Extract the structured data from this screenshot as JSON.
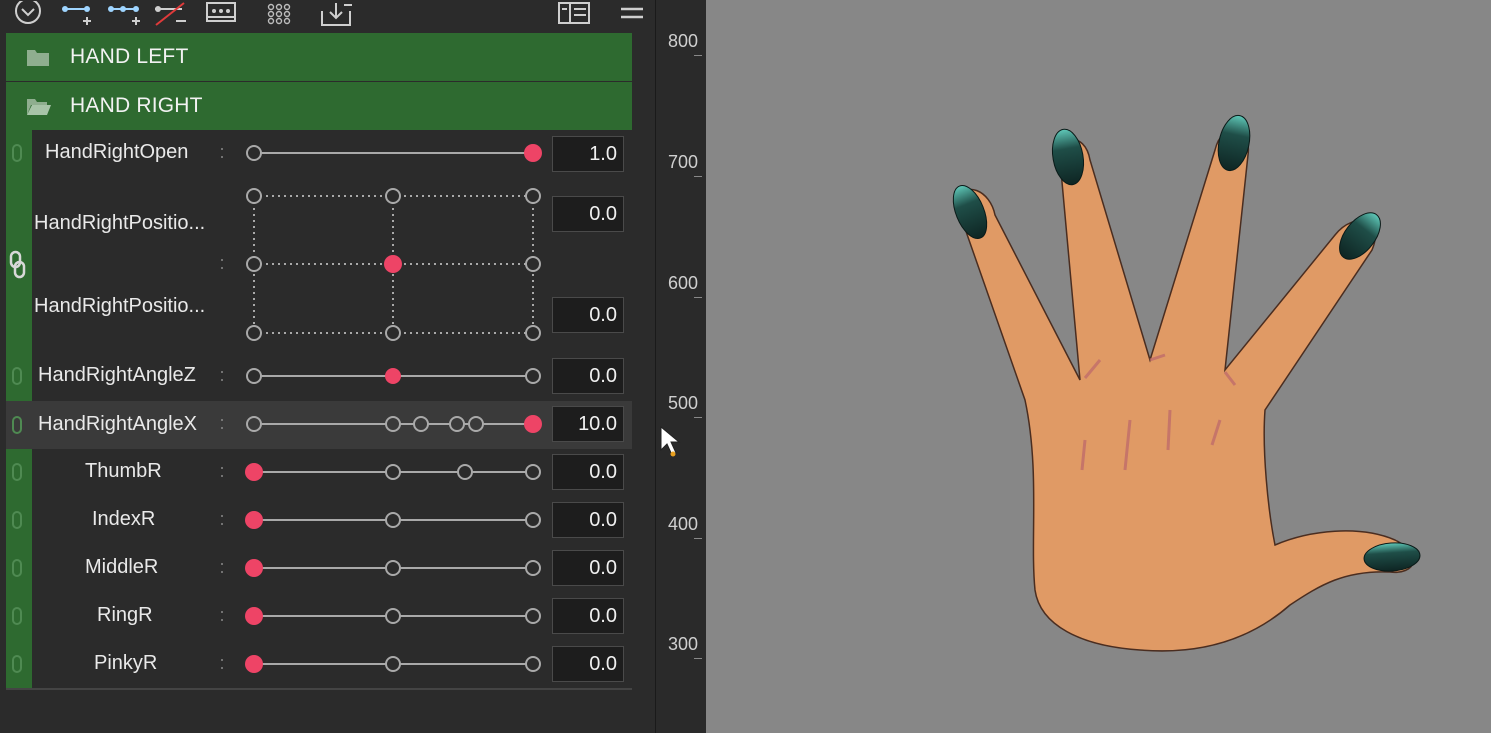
{
  "toolbar": {
    "icons": [
      "expand-circle-icon",
      "add-point-icon",
      "add-three-points-icon",
      "remove-point-icon",
      "keyform-grid-icon",
      "dots-grid-icon",
      "import-icon",
      "display-settings-icon",
      "menu-icon"
    ]
  },
  "groups": [
    {
      "label": "HAND LEFT",
      "icon": "folder-closed-icon"
    },
    {
      "label": "HAND RIGHT",
      "icon": "folder-open-icon"
    }
  ],
  "params": [
    {
      "name": "HandRightOpen",
      "value": "1.0"
    },
    {
      "name_top": "HandRightPositio...",
      "name_bottom": "HandRightPositio...",
      "value_top": "0.0",
      "value_bottom": "0.0"
    },
    {
      "name": "HandRightAngleZ",
      "value": "0.0"
    },
    {
      "name": "HandRightAngleX",
      "value": "10.0"
    },
    {
      "name": "ThumbR",
      "value": "0.0"
    },
    {
      "name": "IndexR",
      "value": "0.0"
    },
    {
      "name": "MiddleR",
      "value": "0.0"
    },
    {
      "name": "RingR",
      "value": "0.0"
    },
    {
      "name": "PinkyR",
      "value": "0.0"
    }
  ],
  "ruler": {
    "labels": [
      "800",
      "700",
      "600",
      "500",
      "400",
      "300"
    ]
  },
  "colors": {
    "accent_knob": "#ee4466",
    "group_green": "#2e6a30",
    "canvas_bg": "#878787",
    "skin": "#e09a65",
    "nail": "#163a36"
  }
}
